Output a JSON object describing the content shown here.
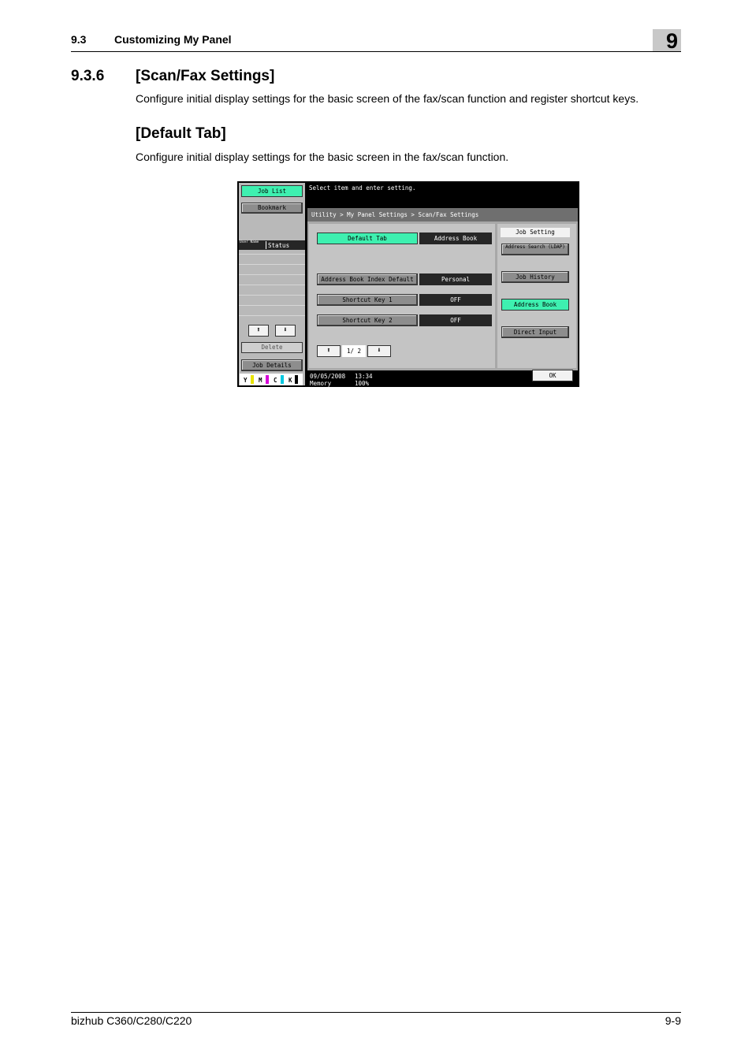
{
  "header": {
    "section": "9.3",
    "title": "Customizing My Panel",
    "chapter": "9"
  },
  "section": {
    "number": "9.3.6",
    "title": "[Scan/Fax Settings]",
    "intro": "Configure initial display settings for the basic screen of the fax/scan function and register shortcut keys."
  },
  "subsection": {
    "title": "[Default Tab]",
    "intro": "Configure initial display settings for the basic screen in the fax/scan function."
  },
  "screen": {
    "message": "Select item and enter setting.",
    "breadcrumb": "Utility > My Panel Settings > Scan/Fax Settings",
    "left": {
      "job_list": "Job List",
      "bookmark": "Bookmark",
      "user_name": "User Name",
      "status": "Status",
      "up_arrow": "⬆",
      "down_arrow": "⬇",
      "delete": "Delete",
      "job_details": "Job Details",
      "toners": [
        "Y",
        "M",
        "C",
        "K"
      ]
    },
    "settings": [
      {
        "label": "Default Tab",
        "value": "Address Book"
      },
      {
        "label": "Address Book Index Default",
        "value": "Personal"
      },
      {
        "label": "Shortcut Key 1",
        "value": "OFF"
      },
      {
        "label": "Shortcut Key 2",
        "value": "OFF"
      }
    ],
    "pager": {
      "up": "⬆",
      "page": "1/ 2",
      "down": "⬇"
    },
    "right": {
      "job_setting": "Job Setting",
      "address_search": "Address Search (LDAP)",
      "job_history": "Job History",
      "address_book": "Address Book",
      "direct_input": "Direct Input"
    },
    "footer": {
      "date": "09/05/2008",
      "time": "13:34",
      "memory_label": "Memory",
      "memory_value": "100%",
      "ok": "OK"
    },
    "colors": {
      "green": "#3ef0b0",
      "yellow": "#e8e400",
      "magenta": "#d800d8",
      "cyan": "#00c8e0",
      "black": "#000000"
    }
  },
  "footer": {
    "product": "bizhub C360/C280/C220",
    "page": "9-9"
  }
}
